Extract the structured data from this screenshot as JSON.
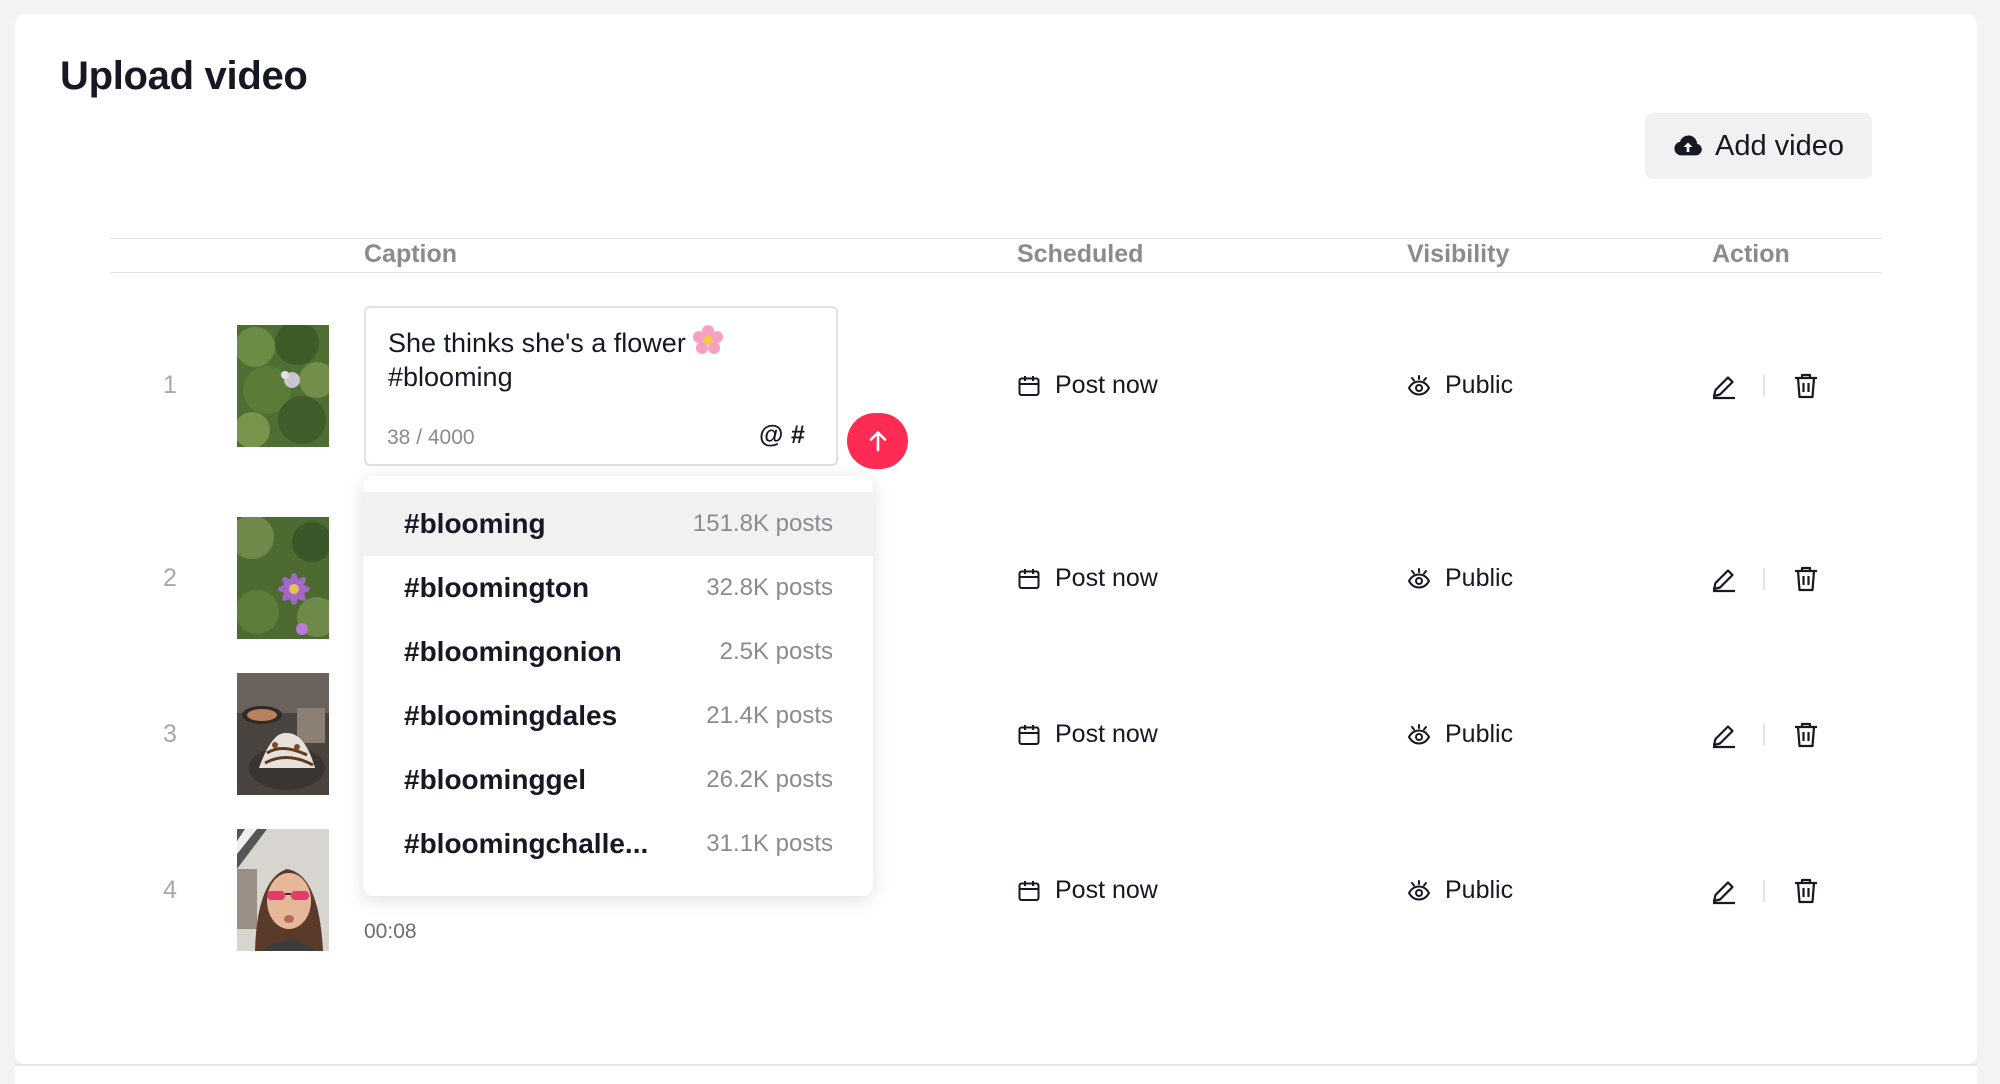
{
  "page": {
    "title": "Upload video"
  },
  "toolbar": {
    "add_video_label": "Add video"
  },
  "table": {
    "headers": {
      "caption": "Caption",
      "scheduled": "Scheduled",
      "visibility": "Visibility",
      "action": "Action"
    },
    "rows": [
      {
        "num": "1",
        "scheduled": "Post now",
        "visibility": "Public"
      },
      {
        "num": "2",
        "scheduled": "Post now",
        "visibility": "Public"
      },
      {
        "num": "3",
        "scheduled": "Post now",
        "visibility": "Public"
      },
      {
        "num": "4",
        "scheduled": "Post now",
        "visibility": "Public",
        "duration": "00:08"
      }
    ]
  },
  "caption_editor": {
    "text": "She thinks she's a flower",
    "hashtag": "#blooming",
    "emoji": "flower-emoji",
    "char_count": "38 / 4000",
    "mention_symbol": "@",
    "hashtag_symbol": "#"
  },
  "hashtag_suggestions": [
    {
      "tag": "#blooming",
      "count": "151.8K posts"
    },
    {
      "tag": "#bloomington",
      "count": "32.8K posts"
    },
    {
      "tag": "#bloomingonion",
      "count": "2.5K posts"
    },
    {
      "tag": "#bloomingdales",
      "count": "21.4K posts"
    },
    {
      "tag": "#bloominggel",
      "count": "26.2K posts"
    },
    {
      "tag": "#bloomingchalle...",
      "count": "31.1K posts"
    }
  ],
  "colors": {
    "accent": "#fe2c55",
    "text": "#161823",
    "muted": "#8a8b91"
  },
  "icons": {
    "add_video": "cloud-upload-icon",
    "scheduled": "calendar-icon",
    "visibility": "eye-icon",
    "edit": "pencil-icon",
    "delete": "trash-icon",
    "send": "arrow-up-icon"
  }
}
